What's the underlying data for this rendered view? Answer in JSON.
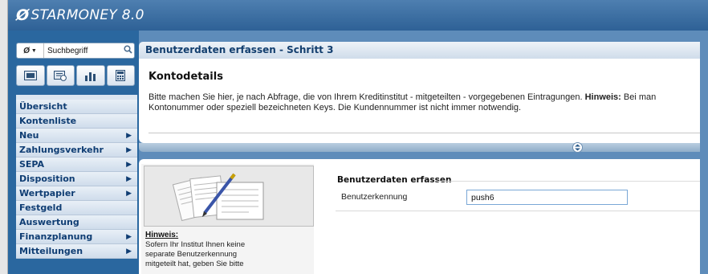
{
  "app": {
    "title": "STARMONEY 8.0",
    "brand_color": "#1f5d95"
  },
  "search": {
    "scope_icon": "starmoney-mini-icon",
    "placeholder": "Suchbegriff"
  },
  "toolbar": {
    "buttons": [
      "accounts-icon",
      "statements-icon",
      "chart-icon",
      "calculator-icon"
    ]
  },
  "sidebar": {
    "items": [
      {
        "label": "Übersicht",
        "has_arrow": false
      },
      {
        "label": "Kontenliste",
        "has_arrow": false
      },
      {
        "label": "Neu",
        "has_arrow": true
      },
      {
        "label": "Zahlungsverkehr",
        "has_arrow": true
      },
      {
        "label": "SEPA",
        "has_arrow": true
      },
      {
        "label": "Disposition",
        "has_arrow": true
      },
      {
        "label": "Wertpapier",
        "has_arrow": true
      },
      {
        "label": "Festgeld",
        "has_arrow": false
      },
      {
        "label": "Auswertung",
        "has_arrow": false
      },
      {
        "label": "Finanzplanung",
        "has_arrow": true
      },
      {
        "label": "Mitteilungen",
        "has_arrow": true
      }
    ]
  },
  "main": {
    "step_title": "Benutzerdaten erfassen - Schritt 3",
    "section_title": "Kontodetails",
    "intro_line1": "Bitte machen Sie hier, je nach Abfrage, die von Ihrem Kreditinstitut - mitgeteilten - vorgegebenen Eintragungen.",
    "intro_hint_label": "Hinweis:",
    "intro_hint_text": " Bei man",
    "intro_line2": "Kontonummer oder speziell bezeichneten Keys. Die Kundennummer ist nicht immer notwendig."
  },
  "hint": {
    "title": "Hinweis:",
    "body": "Sofern Ihr Institut Ihnen keine\nseparate Benutzerkennung\nmitgeteilt hat, geben Sie bitte"
  },
  "form": {
    "group_title": "Benutzerdaten erfassen",
    "field_label": "Benutzerkennung",
    "field_value": "push6"
  }
}
